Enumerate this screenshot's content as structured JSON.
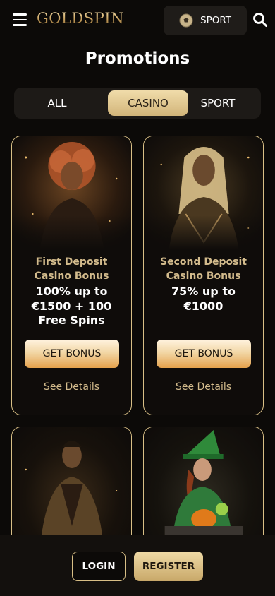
{
  "header": {
    "logo": "GOLDSPIN",
    "sport_label": "SPORT"
  },
  "title": "Promotions",
  "tabs": [
    {
      "label": "ALL"
    },
    {
      "label": "CASINO"
    },
    {
      "label": "SPORT"
    }
  ],
  "active_tab": "CASINO",
  "promos": [
    {
      "subtitle": "First Deposit Casino Bonus",
      "offer": "100% up to €1500 + 100 Free Spins",
      "button": "GET BONUS",
      "details": "See Details"
    },
    {
      "subtitle": "Second Deposit Casino Bonus",
      "offer": "75% up to €1000",
      "button": "GET BONUS",
      "details": "See Details"
    }
  ],
  "footer": {
    "login": "LOGIN",
    "register": "REGISTER"
  },
  "colors": {
    "background": "#0c0a08",
    "gold": "#d8bf86",
    "gold_text": "#d3bb8c",
    "button_orange": "#e5a24d"
  }
}
